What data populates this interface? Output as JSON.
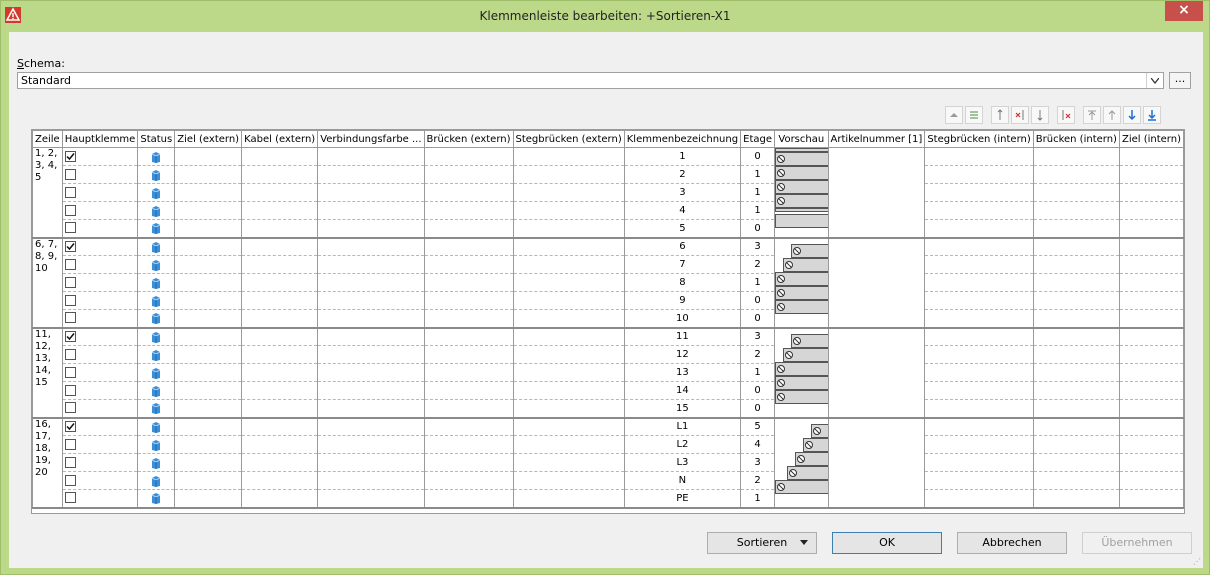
{
  "window": {
    "title": "Klemmenleiste bearbeiten: +Sortieren-X1",
    "close_label": "×"
  },
  "schema": {
    "label": "Schema:",
    "label_accel": "S",
    "label_rest": "chema:",
    "value": "Standard",
    "more_label": "..."
  },
  "columns": [
    "Zeile",
    "Hauptklemme",
    "Status",
    "Ziel (extern)",
    "Kabel (extern)",
    "Verbindungsfarbe ...",
    "Brücken (extern)",
    "Stegbrücken (extern)",
    "Klemmenbezeichnung",
    "Etage",
    "Vorschau",
    "Artikelnummer [1]",
    "Stegbrücken (intern)",
    "Brücken (intern)",
    "Ziel (intern)"
  ],
  "groups": [
    {
      "zeile": "1, 2,\n3, 4,\n5",
      "rows": [
        {
          "haupt": true,
          "bez": "1",
          "etage": "0"
        },
        {
          "haupt": false,
          "bez": "2",
          "etage": "1"
        },
        {
          "haupt": false,
          "bez": "3",
          "etage": "1"
        },
        {
          "haupt": false,
          "bez": "4",
          "etage": "1"
        },
        {
          "haupt": false,
          "bez": "5",
          "etage": "0"
        }
      ]
    },
    {
      "zeile": "6, 7,\n8, 9,\n10",
      "rows": [
        {
          "haupt": true,
          "bez": "6",
          "etage": "3"
        },
        {
          "haupt": false,
          "bez": "7",
          "etage": "2"
        },
        {
          "haupt": false,
          "bez": "8",
          "etage": "1"
        },
        {
          "haupt": false,
          "bez": "9",
          "etage": "0"
        },
        {
          "haupt": false,
          "bez": "10",
          "etage": "0"
        }
      ]
    },
    {
      "zeile": "11,\n12,\n13,\n14,\n15",
      "rows": [
        {
          "haupt": true,
          "bez": "11",
          "etage": "3"
        },
        {
          "haupt": false,
          "bez": "12",
          "etage": "2"
        },
        {
          "haupt": false,
          "bez": "13",
          "etage": "1"
        },
        {
          "haupt": false,
          "bez": "14",
          "etage": "0"
        },
        {
          "haupt": false,
          "bez": "15",
          "etage": "0"
        }
      ]
    },
    {
      "zeile": "16,\n17,\n18,\n19,\n20",
      "rows": [
        {
          "haupt": true,
          "bez": "L1",
          "etage": "5"
        },
        {
          "haupt": false,
          "bez": "L2",
          "etage": "4"
        },
        {
          "haupt": false,
          "bez": "L3",
          "etage": "3"
        },
        {
          "haupt": false,
          "bez": "N",
          "etage": "2"
        },
        {
          "haupt": false,
          "bez": "PE",
          "etage": "1"
        }
      ]
    }
  ],
  "toolbar_icons": [
    "collapse-up-icon",
    "align-center-icon",
    "insert-row-icon",
    "insert-marked-icon",
    "row-height-icon",
    "delete-row-icon",
    "move-top-icon",
    "move-up-icon",
    "move-down-icon",
    "move-bottom-icon"
  ],
  "buttons": {
    "sort": "Sortieren",
    "ok": "OK",
    "cancel": "Abbrechen",
    "apply": "Übernehmen"
  },
  "colors": {
    "titlebar": "#bcd98a",
    "status_icon": "#3a8fd8",
    "close": "#c7504b"
  }
}
